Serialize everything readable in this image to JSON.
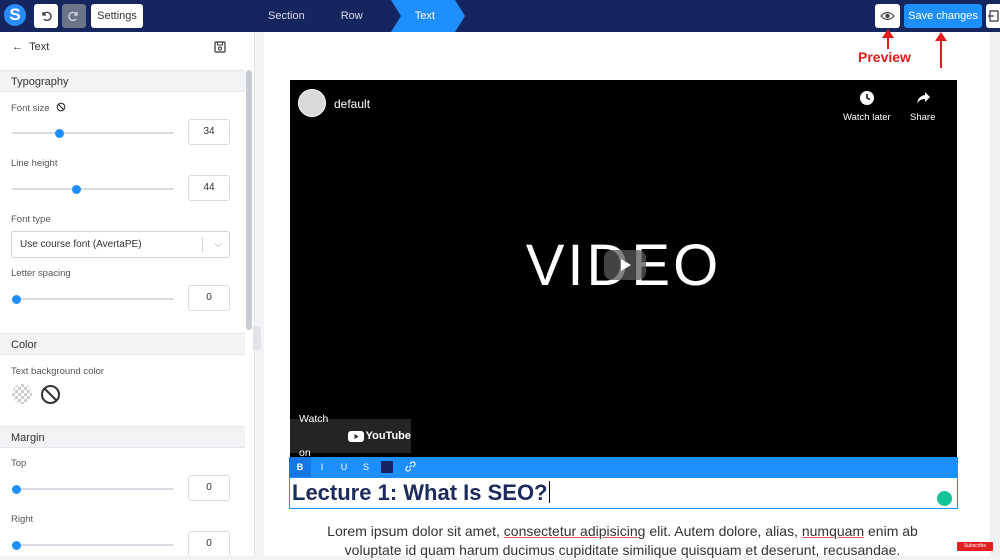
{
  "topbar": {
    "settings_label": "Settings",
    "breadcrumbs": [
      "Section",
      "Row",
      "Text"
    ],
    "save_label": "Save changes"
  },
  "panel": {
    "back_label": "Text",
    "typography": {
      "heading": "Typography",
      "font_size_label": "Font size",
      "font_size_value": "34",
      "line_height_label": "Line height",
      "line_height_value": "44",
      "font_type_label": "Font type",
      "font_type_value": "Use course font (AvertaPE)",
      "letter_spacing_label": "Letter spacing",
      "letter_spacing_value": "0"
    },
    "color": {
      "heading": "Color",
      "text_bg_label": "Text background color"
    },
    "margin": {
      "heading": "Margin",
      "top_label": "Top",
      "top_value": "0",
      "right_label": "Right",
      "right_value": "0"
    }
  },
  "video": {
    "channel": "default",
    "watch_later": "Watch later",
    "share": "Share",
    "overlay_word": "VIDEO",
    "watch_on": "Watch on",
    "youtube": "YouTube"
  },
  "editor": {
    "toolbar": [
      "B",
      "I",
      "U",
      "S"
    ],
    "text_color": "#15265f",
    "heading": "Lecture 1: What Is SEO?"
  },
  "body": {
    "line1_a": "Lorem ipsum dolor sit amet, ",
    "line1_b": "consectetur adipisicing",
    "line1_c": " elit. Autem dolore, alias, ",
    "line1_d": "numquam",
    "line1_e": " enim ab",
    "line2": "voluptate id quam harum ducimus cupiditate similique quisquam et deserunt, recusandae."
  },
  "annotation": {
    "preview_label": "Preview"
  },
  "youtube_subscribe": "Subscribe",
  "colors": {
    "navbar": "#15265f",
    "accent": "#1e8fff",
    "annotation": "#e01b1b"
  }
}
